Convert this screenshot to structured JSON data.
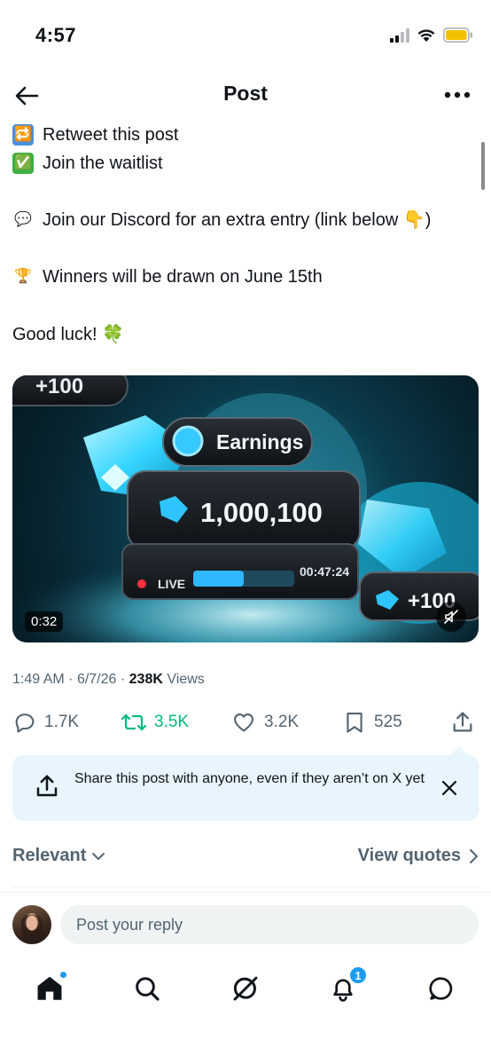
{
  "status_bar": {
    "time": "4:57",
    "icons": [
      "cellular-signal-icon",
      "wifi-icon",
      "battery-icon"
    ],
    "battery_color": "#f2c200"
  },
  "header": {
    "title": "Post",
    "back_icon": "arrow-left-icon",
    "more_icon": "more-horizontal-icon"
  },
  "post": {
    "lines": [
      {
        "emoji": "🔁",
        "icon": "repeat-emoji-icon",
        "text": "Retweet this post"
      },
      {
        "emoji": "✅",
        "icon": "checkmark-emoji-icon",
        "text": "Join the waitlist"
      },
      {
        "emoji": "💬",
        "icon": "speech-bubble-emoji-icon",
        "text": "Join our Discord for an extra entry (link below 👇)"
      },
      {
        "emoji": "🏆",
        "icon": "trophy-emoji-icon",
        "text": "Winners will be drawn on June 15th"
      },
      {
        "emoji": "",
        "icon": "",
        "text": "Good luck! 🍀"
      }
    ]
  },
  "media": {
    "overlay_texts": {
      "earnings_label": "Earnings",
      "earnings_value": "1,000,100",
      "live_label": "LIVE",
      "live_timer": "00:47:24",
      "plus_bottom": "+100",
      "plus_top": "+100"
    },
    "duration": "0:32",
    "live_progress": 0.5,
    "mute_icon": "speaker-muted-icon",
    "accent_color": "#2fd0ff"
  },
  "meta": {
    "time": "1:49 AM",
    "date": "6/7/26",
    "views_count": "238K",
    "views_label": "Views",
    "separator": "·"
  },
  "actions": {
    "replies": "1.7K",
    "reposts": "3.5K",
    "likes": "3.2K",
    "bookmarks": "525",
    "repost_color": "#00ba7c"
  },
  "share_tip": {
    "text": "Share this post with anyone, even if they aren’t on X yet"
  },
  "sort": {
    "left_label": "Relevant",
    "right_label": "View quotes"
  },
  "reply": {
    "placeholder": "Post your reply"
  },
  "bottom_nav": {
    "items": [
      "home-icon",
      "search-icon",
      "grok-icon",
      "notifications-icon",
      "messages-icon"
    ],
    "notification_badge": "1",
    "accent_color": "#1d9bf0"
  }
}
